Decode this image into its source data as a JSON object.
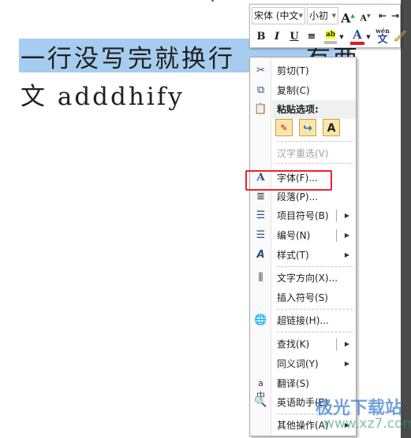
{
  "document": {
    "line1": "一行没写完就换行",
    "line1_after_menu": "有两",
    "line2": "文 adddhify"
  },
  "mini_toolbar": {
    "font_name": "宋体 (中文",
    "font_size": "小初",
    "buttons": [
      "grow-font",
      "shrink-font",
      "decrease-indent",
      "increase-indent",
      "bold",
      "italic",
      "underline",
      "center",
      "highlight",
      "font-color",
      "phonetic-guide",
      "format-painter"
    ],
    "bold": "B",
    "italic": "I",
    "underline": "U",
    "font_color_letter": "A",
    "grow": "A",
    "shrink": "A",
    "highlight_text": "ab",
    "phonetic_top": "wén",
    "phonetic_bottom": "文",
    "font_color": "#e8141c"
  },
  "menu": {
    "cut": "剪切(T)",
    "copy": "复制(C)",
    "paste_header": "粘贴选项:",
    "paste_text_only": "A",
    "reconvert": "汉字重选(V)",
    "font": "字体(F)...",
    "paragraph": "段落(P)...",
    "bullets": "项目符号(B)",
    "numbering": "编号(N)",
    "styles": "样式(T)",
    "text_direction": "文字方向(X)...",
    "insert_symbol": "插入符号(S)",
    "hyperlink": "超链接(H)...",
    "find": "查找(K)",
    "synonyms": "同义词(Y)",
    "translate": "翻译(S)",
    "english_assistant": "英语助手(E)",
    "other_actions": "其他操作(A)"
  },
  "highlight_box_color": "#f0202a",
  "selection_color": "#a6cdf0",
  "watermark": {
    "name": "极光下载站",
    "url": "www.xz7.com"
  }
}
